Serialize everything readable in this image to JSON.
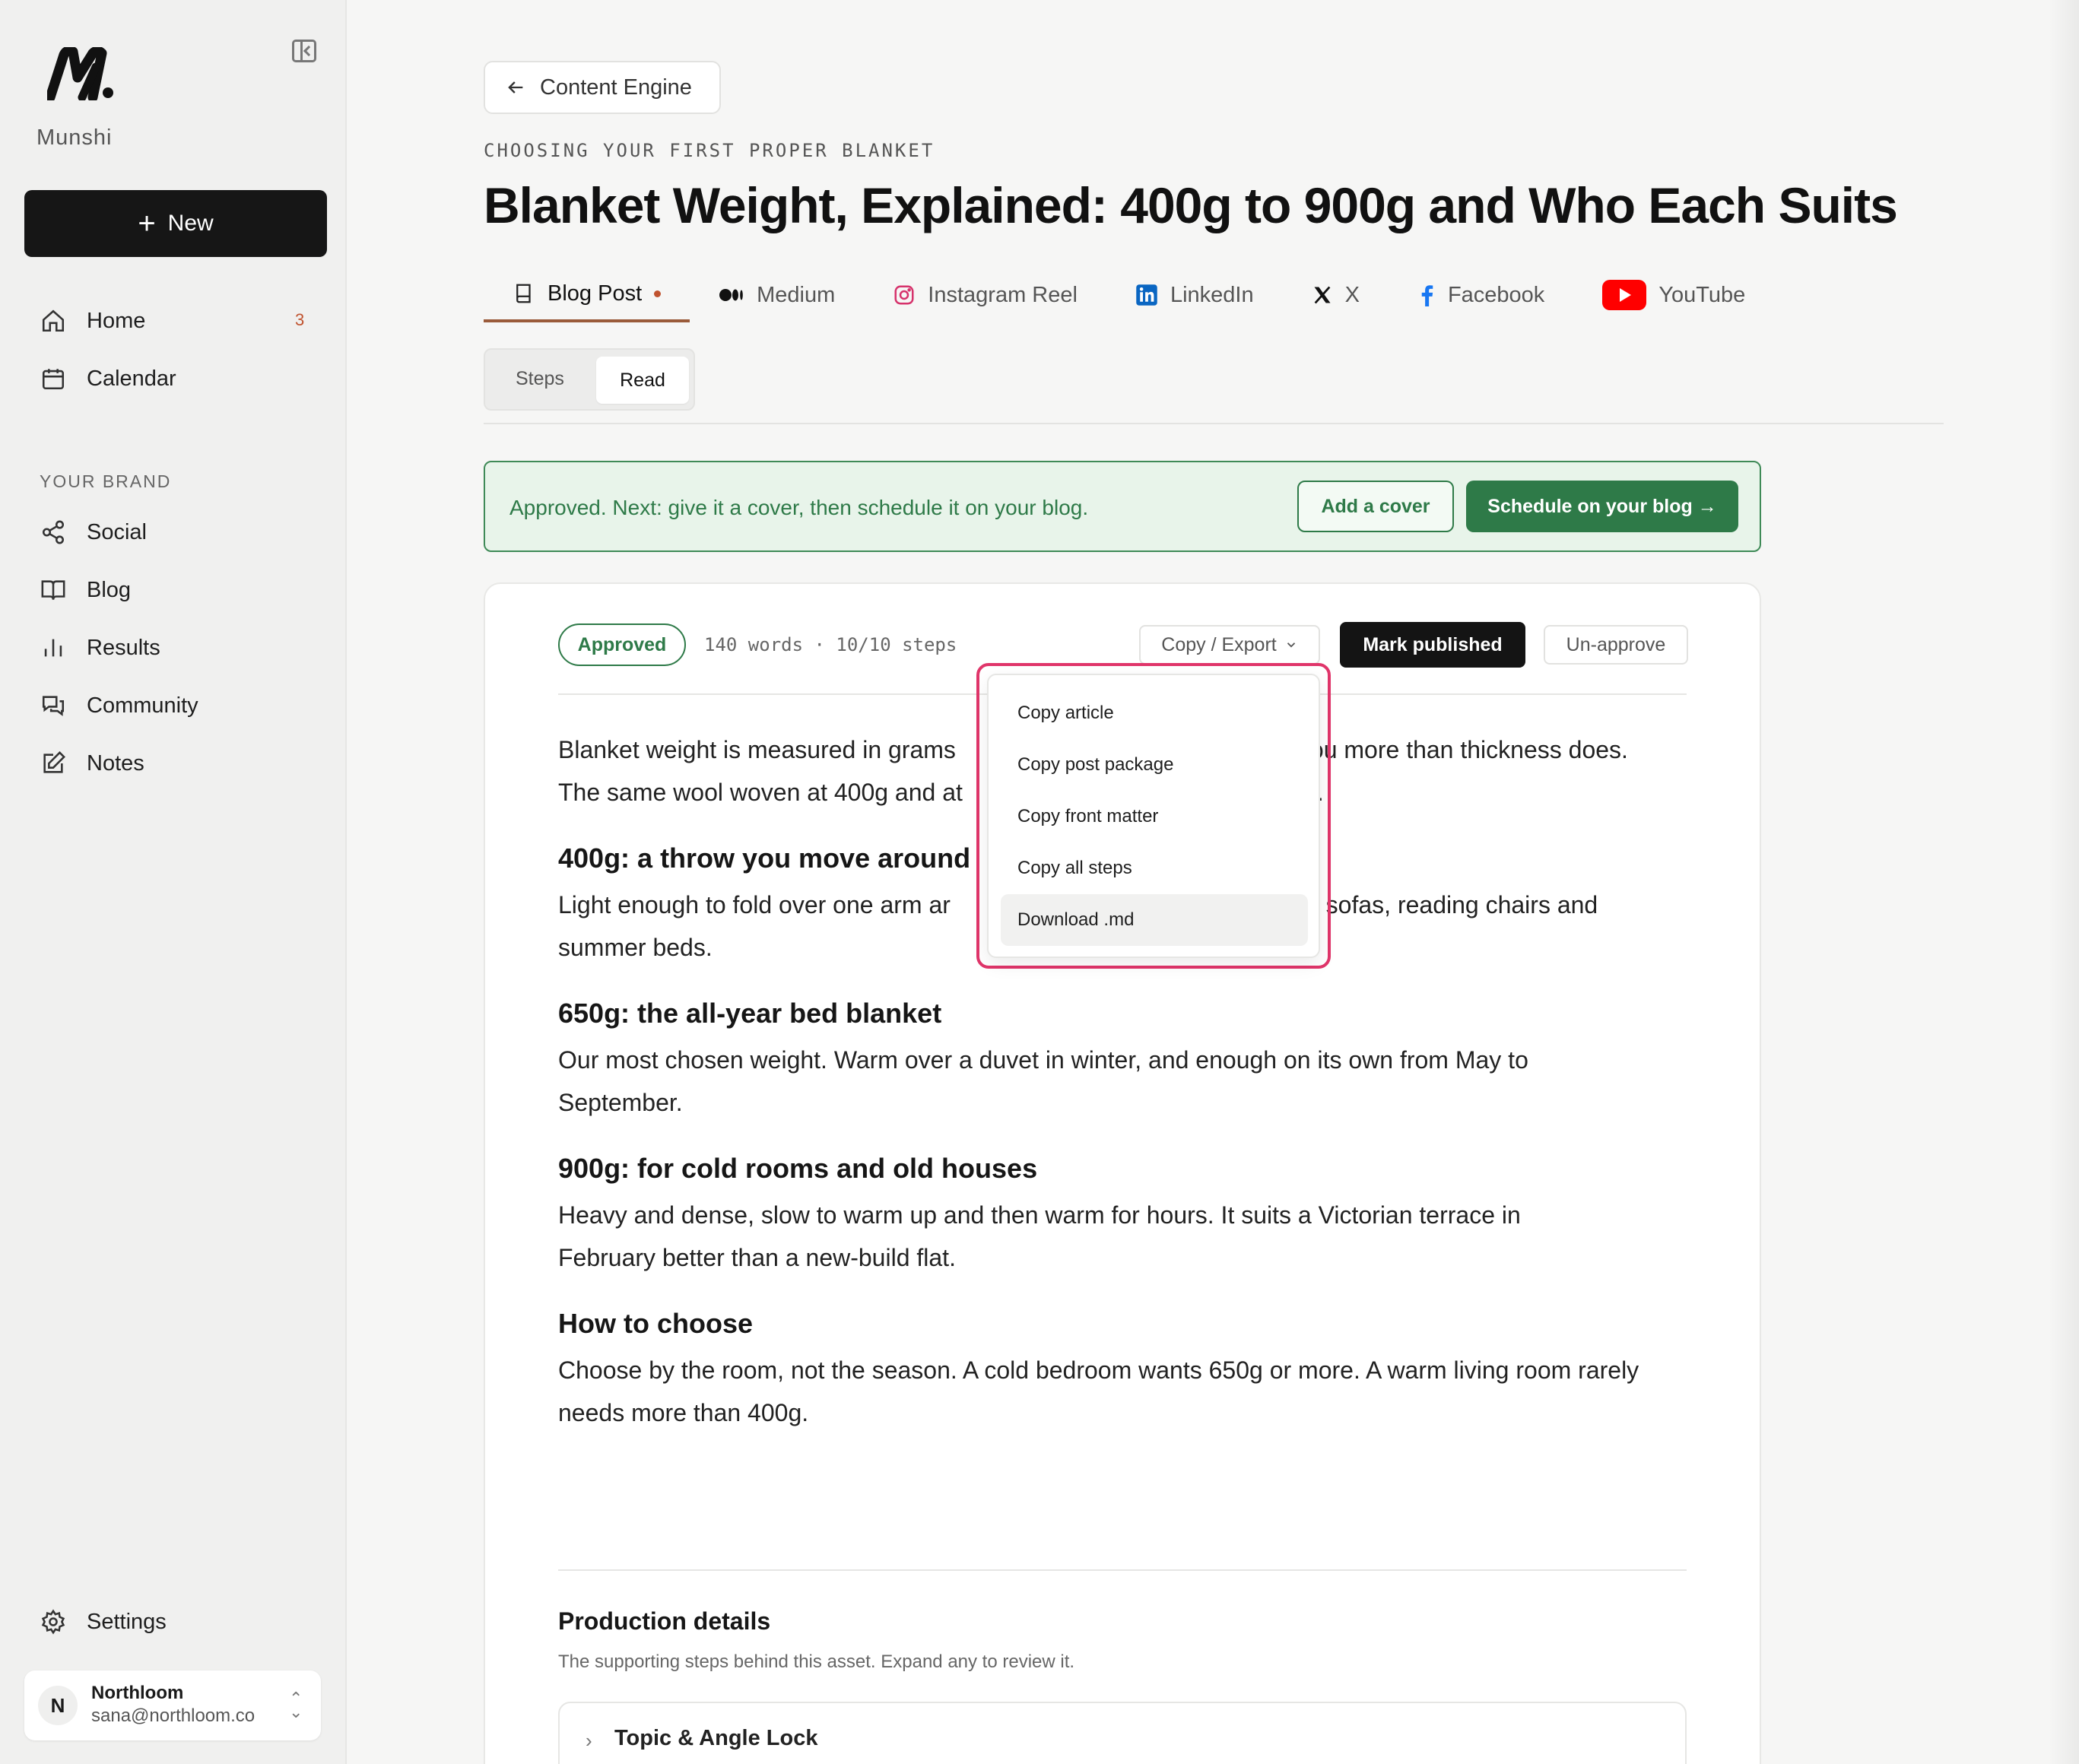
{
  "app": {
    "brand_name": "Munshi"
  },
  "sidebar": {
    "new_label": "New",
    "nav": [
      {
        "label": "Home",
        "icon": "home-icon",
        "badge": "3"
      },
      {
        "label": "Calendar",
        "icon": "calendar-icon"
      }
    ],
    "section_label": "YOUR BRAND",
    "brand_nav": [
      {
        "label": "Social",
        "icon": "share-icon"
      },
      {
        "label": "Blog",
        "icon": "book-open-icon"
      },
      {
        "label": "Results",
        "icon": "bar-chart-icon"
      },
      {
        "label": "Community",
        "icon": "chat-icon"
      },
      {
        "label": "Notes",
        "icon": "edit-icon"
      }
    ],
    "settings_label": "Settings",
    "user": {
      "initial": "N",
      "name": "Northloom",
      "email": "sana@northloom.co"
    }
  },
  "header": {
    "back_label": "Content Engine",
    "eyebrow": "CHOOSING YOUR FIRST PROPER BLANKET",
    "title": "Blanket Weight, Explained: 400g to 900g and Who Each Suits"
  },
  "channel_tabs": [
    {
      "label": "Blog Post",
      "icon": "book-icon",
      "active": true
    },
    {
      "label": "Medium",
      "icon": "medium-icon"
    },
    {
      "label": "Instagram Reel",
      "icon": "instagram-icon"
    },
    {
      "label": "LinkedIn",
      "icon": "linkedin-icon"
    },
    {
      "label": "X",
      "icon": "x-icon"
    },
    {
      "label": "Facebook",
      "icon": "facebook-icon"
    },
    {
      "label": "YouTube",
      "icon": "youtube-icon"
    }
  ],
  "view_toggle": {
    "steps_label": "Steps",
    "read_label": "Read",
    "selected": "Read"
  },
  "notice": {
    "text": "Approved. Next: give it a cover, then schedule it on your blog.",
    "cover_label": "Add a cover",
    "schedule_label": "Schedule on your blog →"
  },
  "article_toolbar": {
    "status": "Approved",
    "meta": "140 words · 10/10 steps",
    "copy_export_label": "Copy / Export",
    "mark_published_label": "Mark published",
    "unapprove_label": "Un-approve"
  },
  "dropdown": {
    "items": [
      "Copy article",
      "Copy post package",
      "Copy front matter",
      "Copy all steps",
      "Download .md"
    ],
    "hovered": "Download .md"
  },
  "article": {
    "intro_a": "Blanket weight is measured in grams",
    "intro_b": "you more than thickness does.",
    "intro_c": "The same wool woven at 400g and at",
    "intro_d": "s.",
    "h1": "400g: a throw you move around",
    "p1_a": "Light enough to fold over one arm ar",
    "p1_b": "ts sofas, reading chairs and",
    "p1_c": "summer beds.",
    "h2": "650g: the all-year bed blanket",
    "p2": "Our most chosen weight. Warm over a duvet in winter, and enough on its own from May to September.",
    "h3": "900g: for cold rooms and old houses",
    "p3": "Heavy and dense, slow to warm up and then warm for hours. It suits a Victorian terrace in February better than a new-build flat.",
    "h4": "How to choose",
    "p4": "Choose by the room, not the season. A cold bedroom wants 650g or more. A warm living room rarely needs more than 400g."
  },
  "production": {
    "title": "Production details",
    "subtitle": "The supporting steps behind this asset. Expand any to review it.",
    "first_step": "Topic & Angle Lock"
  },
  "colors": {
    "accent_tab": "#9a5b3a",
    "approved_green": "#2e7a48",
    "highlight_pink": "#e0356a"
  }
}
